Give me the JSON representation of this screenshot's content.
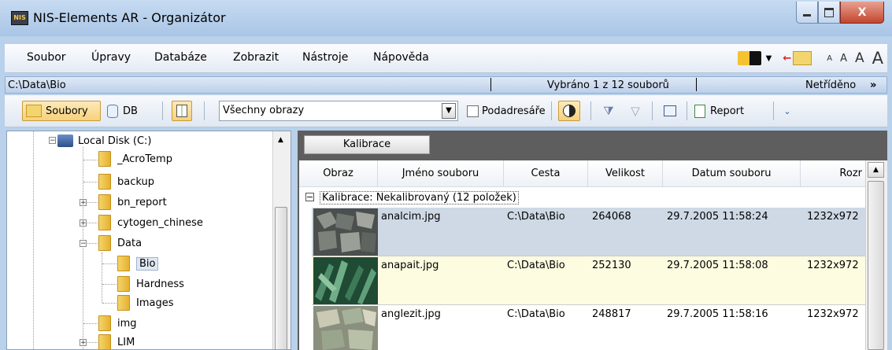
{
  "window": {
    "title": "NIS-Elements AR - Organizátor",
    "app_icon": "NIS",
    "close_glyph": "X"
  },
  "menu": {
    "items": [
      "Soubor",
      "Úpravy",
      "Databáze",
      "Zobrazit",
      "Nástroje",
      "Nápověda"
    ],
    "font_sizes": [
      "A",
      "A",
      "A",
      "A"
    ]
  },
  "pathbar": {
    "path": "C:\\Data\\Bio",
    "selection": "Vybráno 1 z 12 souborů",
    "sort": "Netříděno",
    "more": "»"
  },
  "toolbar": {
    "files_label": "Soubory",
    "db_label": "DB",
    "filter_value": "Všechny obrazy",
    "subfolders_label": "Podadresáře",
    "report_label": "Report"
  },
  "tree": {
    "items": [
      {
        "label": "Local Disk (C:)"
      },
      {
        "label": "_AcroTemp"
      },
      {
        "label": "backup"
      },
      {
        "label": "bn_report"
      },
      {
        "label": "cytogen_chinese"
      },
      {
        "label": "Data"
      },
      {
        "label": "Bio"
      },
      {
        "label": "Hardness"
      },
      {
        "label": "Images"
      },
      {
        "label": "img"
      },
      {
        "label": "LIM"
      }
    ]
  },
  "grid": {
    "tab_label": "Kalibrace",
    "columns": [
      "Obraz",
      "Jméno souboru",
      "Cesta",
      "Velikost",
      "Datum souboru",
      "Rozr"
    ],
    "group_label": "Kalibrace: Nekalibrovaný (12 položek)",
    "rows": [
      {
        "name": "analcim.jpg",
        "path": "C:\\Data\\Bio",
        "size": "264068",
        "date": "29.7.2005 11:58:24",
        "res": "1232x972"
      },
      {
        "name": "anapait.jpg",
        "path": "C:\\Data\\Bio",
        "size": "252130",
        "date": "29.7.2005 11:58:08",
        "res": "1232x972"
      },
      {
        "name": "anglezit.jpg",
        "path": "C:\\Data\\Bio",
        "size": "248817",
        "date": "29.7.2005 11:58:16",
        "res": "1232x972"
      }
    ]
  },
  "colors": {
    "selected_row": "#cfd9e6",
    "highlight_row": "#fdfbe0",
    "tree_selection": "#dfe7f2"
  }
}
